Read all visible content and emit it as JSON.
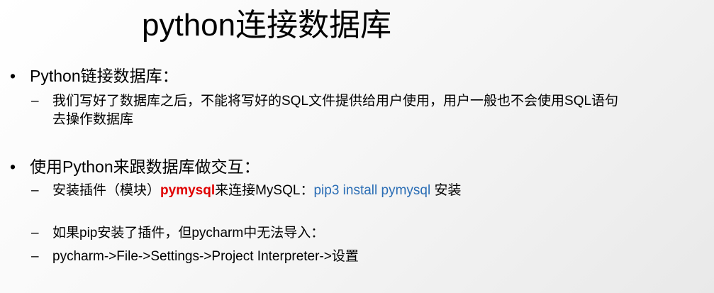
{
  "title": "python连接数据库",
  "bullets": [
    {
      "text": "Python链接数据库：",
      "subs": [
        {
          "line1": "我们写好了数据库之后，不能将写好的SQL文件提供给用户使用，用户一般也不会使用SQL语句",
          "line2": "去操作数据库"
        }
      ]
    },
    {
      "text": "使用Python来跟数据库做交互：",
      "subs": [
        {
          "part1": "安装插件（模块）",
          "highlight": "pymysql",
          "part2": "来连接MySQL：",
          "command": "pip3 install pymysql",
          "part3": " 安装"
        },
        {
          "text": "如果pip安装了插件，但pycharm中无法导入："
        },
        {
          "text": "pycharm->File->Settings->Project Interpreter->设置"
        }
      ]
    }
  ],
  "markers": {
    "bullet": "•",
    "dash": "–"
  },
  "colors": {
    "highlight": "#e00000",
    "command": "#2a6db5"
  }
}
